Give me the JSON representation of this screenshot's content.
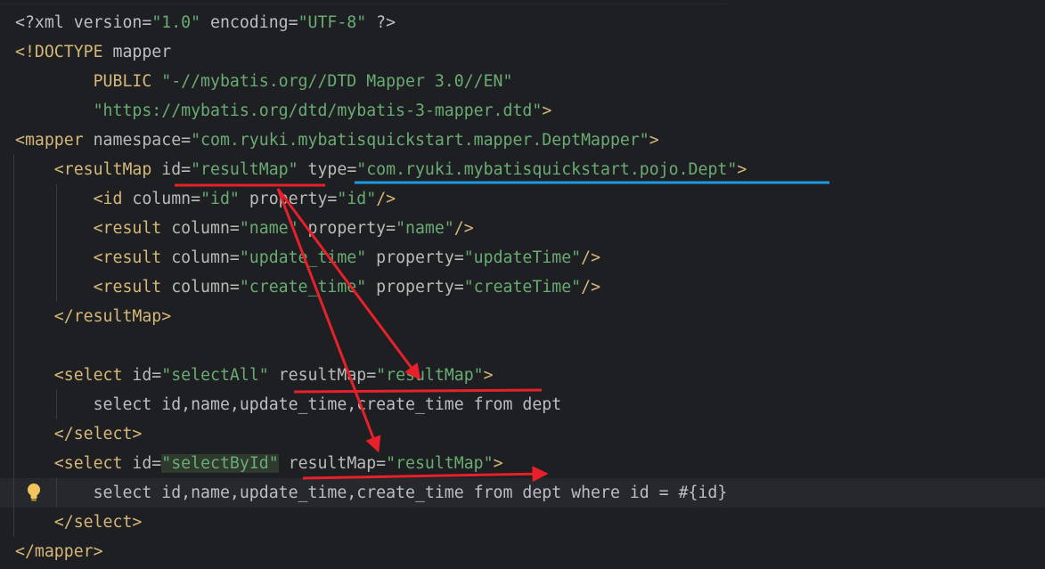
{
  "editor": {
    "language": "xml",
    "lines": [
      {
        "tokens": [
          {
            "t": "<?xml version=",
            "c": "pi"
          },
          {
            "t": "\"1.0\"",
            "c": "val"
          },
          {
            "t": " encoding=",
            "c": "pi"
          },
          {
            "t": "\"UTF-8\"",
            "c": "val"
          },
          {
            "t": " ?>",
            "c": "pi"
          }
        ]
      },
      {
        "tokens": [
          {
            "t": "<!DOCTYPE ",
            "c": "doctype"
          },
          {
            "t": "mapper",
            "c": "txt"
          }
        ]
      },
      {
        "tokens": [
          {
            "t": "        PUBLIC ",
            "c": "doctype"
          },
          {
            "t": "\"-//mybatis.org//DTD Mapper 3.0//EN\"",
            "c": "val"
          }
        ]
      },
      {
        "tokens": [
          {
            "t": "        ",
            "c": "txt"
          },
          {
            "t": "\"https://mybatis.org/dtd/mybatis-3-mapper.dtd\"",
            "c": "val"
          },
          {
            "t": ">",
            "c": "doctype"
          }
        ]
      },
      {
        "tokens": [
          {
            "t": "<mapper ",
            "c": "tag"
          },
          {
            "t": "namespace=",
            "c": "attr"
          },
          {
            "t": "\"com.ryuki.mybatisquickstart.mapper.DeptMapper\"",
            "c": "val"
          },
          {
            "t": ">",
            "c": "tag"
          }
        ]
      },
      {
        "tokens": [
          {
            "t": "    <resultMap ",
            "c": "tag"
          },
          {
            "t": "id=",
            "c": "attr"
          },
          {
            "t": "\"resultMap\"",
            "c": "val"
          },
          {
            "t": " ",
            "c": "txt"
          },
          {
            "t": "type=",
            "c": "attr"
          },
          {
            "t": "\"com.ryuki.mybatisquickstart.pojo.Dept\"",
            "c": "val"
          },
          {
            "t": ">",
            "c": "tag"
          }
        ]
      },
      {
        "tokens": [
          {
            "t": "        <id ",
            "c": "tag"
          },
          {
            "t": "column=",
            "c": "attr"
          },
          {
            "t": "\"id\"",
            "c": "val"
          },
          {
            "t": " property=",
            "c": "attr"
          },
          {
            "t": "\"id\"",
            "c": "val"
          },
          {
            "t": "/>",
            "c": "tag"
          }
        ]
      },
      {
        "tokens": [
          {
            "t": "        <result ",
            "c": "tag"
          },
          {
            "t": "column=",
            "c": "attr"
          },
          {
            "t": "\"name\"",
            "c": "val"
          },
          {
            "t": " property=",
            "c": "attr"
          },
          {
            "t": "\"name\"",
            "c": "val"
          },
          {
            "t": "/>",
            "c": "tag"
          }
        ]
      },
      {
        "tokens": [
          {
            "t": "        <result ",
            "c": "tag"
          },
          {
            "t": "column=",
            "c": "attr"
          },
          {
            "t": "\"update_time\"",
            "c": "val"
          },
          {
            "t": " property=",
            "c": "attr"
          },
          {
            "t": "\"updateTime\"",
            "c": "val"
          },
          {
            "t": "/>",
            "c": "tag"
          }
        ]
      },
      {
        "tokens": [
          {
            "t": "        <result ",
            "c": "tag"
          },
          {
            "t": "column=",
            "c": "attr"
          },
          {
            "t": "\"create_time\"",
            "c": "val"
          },
          {
            "t": " property=",
            "c": "attr"
          },
          {
            "t": "\"createTime\"",
            "c": "val"
          },
          {
            "t": "/>",
            "c": "tag"
          }
        ]
      },
      {
        "tokens": [
          {
            "t": "    </resultMap>",
            "c": "tag"
          }
        ]
      },
      {
        "tokens": []
      },
      {
        "tokens": [
          {
            "t": "    <select ",
            "c": "tag"
          },
          {
            "t": "id=",
            "c": "attr"
          },
          {
            "t": "\"selectAll\"",
            "c": "val"
          },
          {
            "t": " resultMap=",
            "c": "attr"
          },
          {
            "t": "\"resultMap\"",
            "c": "val"
          },
          {
            "t": ">",
            "c": "tag"
          }
        ]
      },
      {
        "tokens": [
          {
            "t": "        select id,name,update_time,create_time from dept",
            "c": "txt"
          }
        ]
      },
      {
        "tokens": [
          {
            "t": "    </select>",
            "c": "tag"
          }
        ]
      },
      {
        "tokens": [
          {
            "t": "    <select ",
            "c": "tag"
          },
          {
            "t": "id=",
            "c": "attr"
          },
          {
            "t": "\"selectById\"",
            "c": "val"
          },
          {
            "t": " resultMap=",
            "c": "attr"
          },
          {
            "t": "\"resultMap\"",
            "c": "val"
          },
          {
            "t": ">",
            "c": "tag"
          }
        ]
      },
      {
        "tokens": [
          {
            "t": "        select id,name,update_time,create_time from dept where id = #{id}",
            "c": "txt"
          }
        ]
      },
      {
        "tokens": [
          {
            "t": "    </select>",
            "c": "tag"
          }
        ]
      },
      {
        "tokens": [
          {
            "t": "</mapper>",
            "c": "tag"
          }
        ]
      }
    ],
    "caret_line": 17,
    "gutter_icon": "lightbulb-icon"
  },
  "colors": {
    "background": "#1e1f22",
    "tag": "#d5b778",
    "attribute": "#bababa",
    "value": "#6aab73",
    "text": "#bcbec4",
    "annotation_red": "#e8202a",
    "annotation_blue": "#1e9be0"
  }
}
